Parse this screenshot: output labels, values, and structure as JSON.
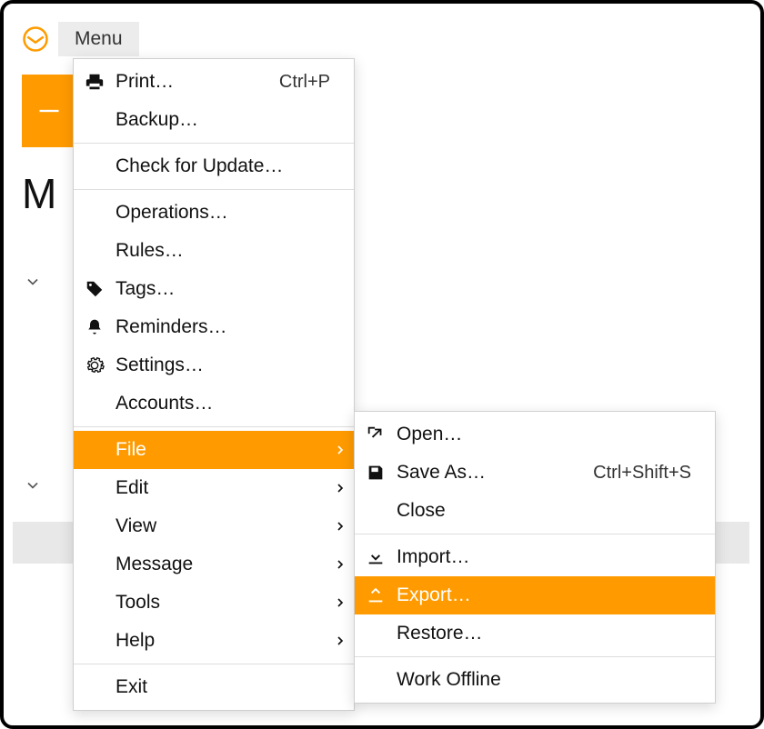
{
  "topbar": {
    "menu_label": "Menu"
  },
  "sidebar": {
    "heading_letter": "M"
  },
  "main_menu": {
    "print": {
      "label": "Print…",
      "shortcut": "Ctrl+P"
    },
    "backup": {
      "label": "Backup…"
    },
    "check_update": {
      "label": "Check for Update…"
    },
    "operations": {
      "label": "Operations…"
    },
    "rules": {
      "label": "Rules…"
    },
    "tags": {
      "label": "Tags…"
    },
    "reminders": {
      "label": "Reminders…"
    },
    "settings": {
      "label": "Settings…"
    },
    "accounts": {
      "label": "Accounts…"
    },
    "file": {
      "label": "File"
    },
    "edit": {
      "label": "Edit"
    },
    "view": {
      "label": "View"
    },
    "message": {
      "label": "Message"
    },
    "tools": {
      "label": "Tools"
    },
    "help": {
      "label": "Help"
    },
    "exit": {
      "label": "Exit"
    }
  },
  "file_submenu": {
    "open": {
      "label": "Open…"
    },
    "save_as": {
      "label": "Save As…",
      "shortcut": "Ctrl+Shift+S"
    },
    "close": {
      "label": "Close"
    },
    "import": {
      "label": "Import…"
    },
    "export": {
      "label": "Export…"
    },
    "restore": {
      "label": "Restore…"
    },
    "work_offline": {
      "label": "Work Offline"
    }
  },
  "colors": {
    "accent": "#ff9b00"
  }
}
